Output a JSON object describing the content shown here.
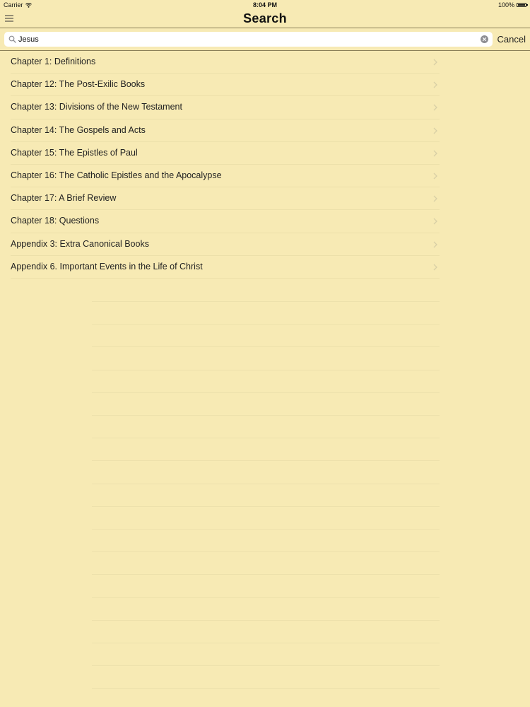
{
  "status_bar": {
    "carrier": "Carrier",
    "time": "8:04 PM",
    "battery": "100%"
  },
  "nav": {
    "title": "Search"
  },
  "search": {
    "value": "Jesus",
    "cancel_label": "Cancel"
  },
  "results": [
    {
      "label": "Chapter 1: Definitions"
    },
    {
      "label": "Chapter 12:  The Post-Exilic Books"
    },
    {
      "label": "Chapter 13: Divisions of the New Testament"
    },
    {
      "label": "Chapter 14: The Gospels and Acts"
    },
    {
      "label": "Chapter 15: The Epistles of Paul"
    },
    {
      "label": "Chapter 16: The Catholic Epistles and the Apocalypse"
    },
    {
      "label": "Chapter 17: A Brief Review"
    },
    {
      "label": "Chapter 18: Questions"
    },
    {
      "label": "Appendix 3:  Extra Canonical Books"
    },
    {
      "label": "Appendix 6. Important Events in the Life of Christ"
    }
  ],
  "colors": {
    "background": "#f7eab4",
    "separator": "#8a7f57",
    "text": "#222222"
  }
}
